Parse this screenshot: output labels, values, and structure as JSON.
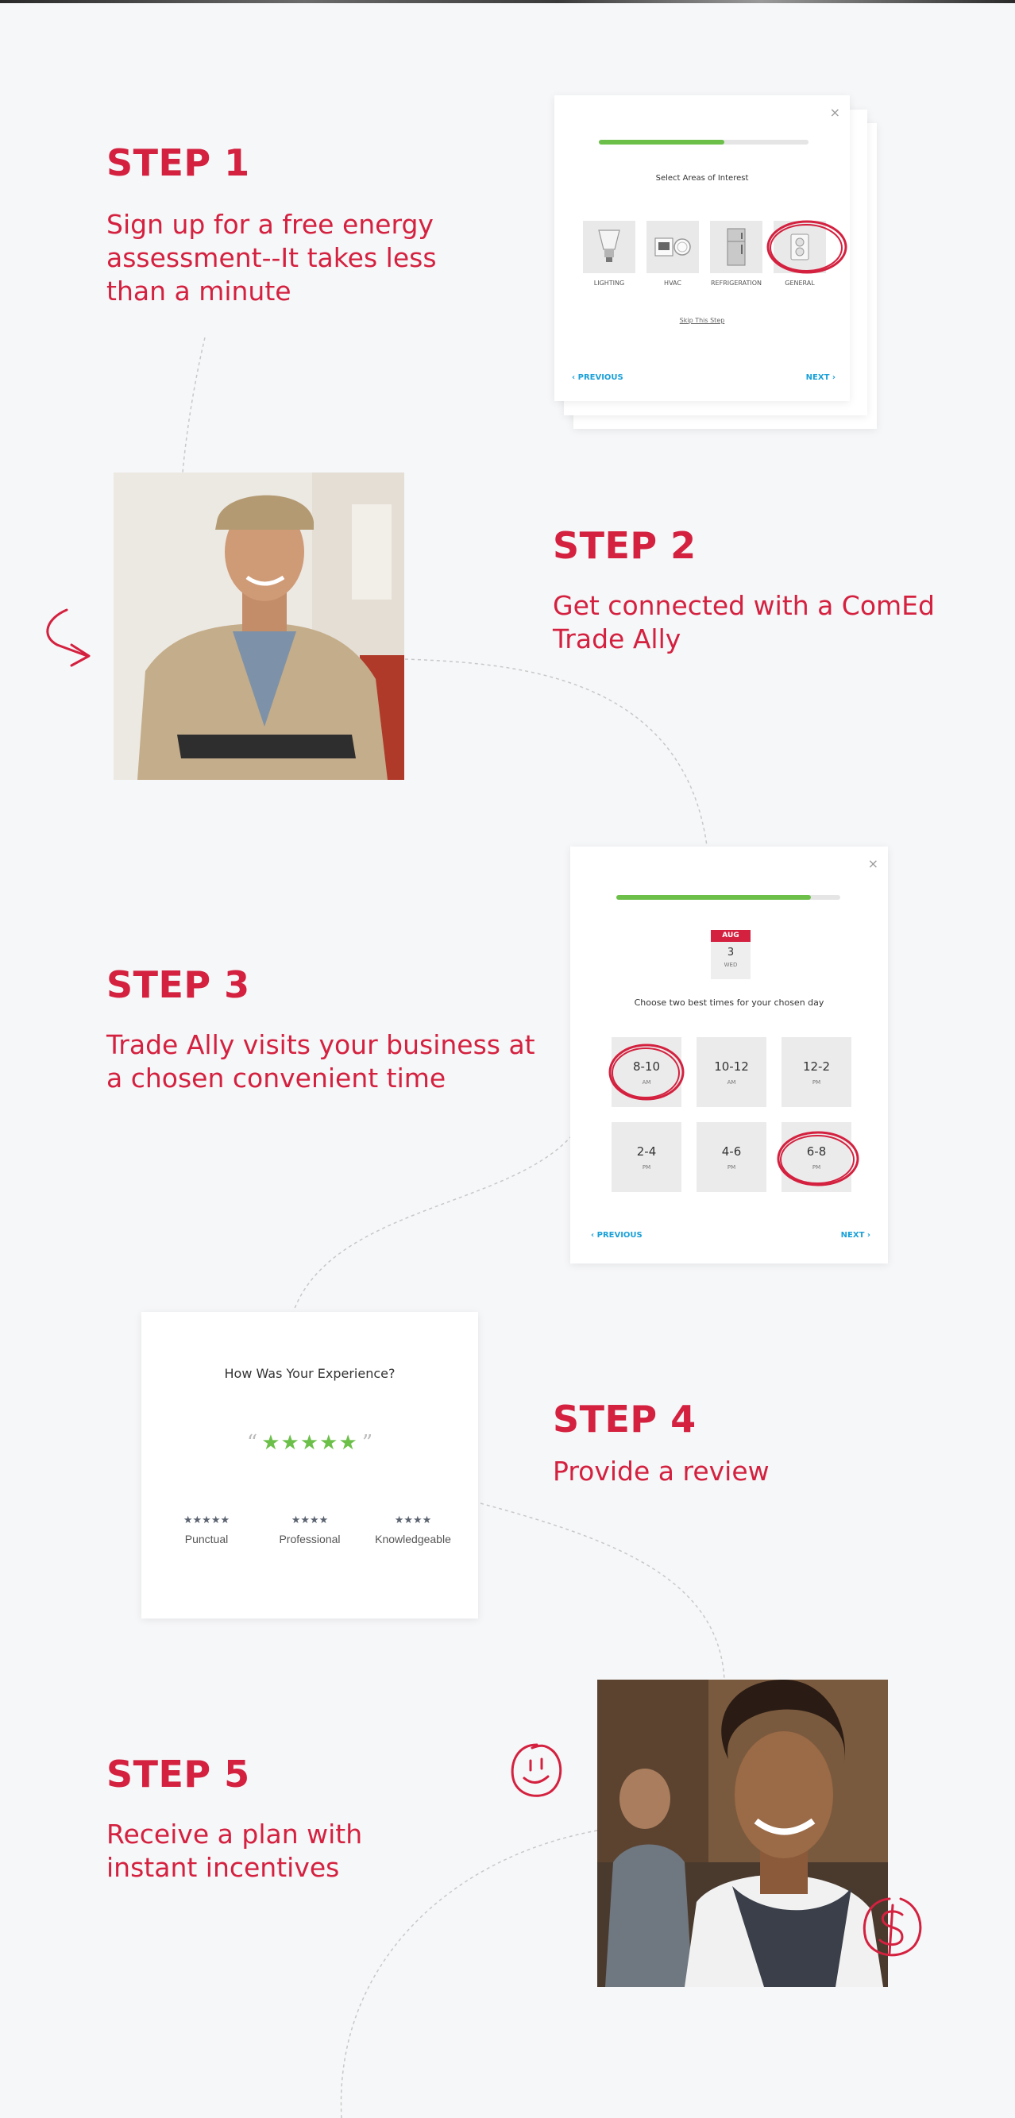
{
  "steps": [
    {
      "title": "STEP 1",
      "text": "Sign up for a free energy assessment--It takes less than a minute"
    },
    {
      "title": "STEP 2",
      "text": "Get connected with a ComEd Trade Ally"
    },
    {
      "title": "STEP 3",
      "text": "Trade Ally visits your business at a chosen convenient time"
    },
    {
      "title": "STEP 4",
      "text": "Provide a review"
    },
    {
      "title": "STEP 5",
      "text": "Receive a plan with instant incentives"
    }
  ],
  "areas_card": {
    "close": "×",
    "progress": 0.6,
    "title": "Select Areas of Interest",
    "areas": [
      {
        "label": "LIGHTING",
        "icon": "light-bulb-icon"
      },
      {
        "label": "HVAC",
        "icon": "thermostat-icon"
      },
      {
        "label": "REFRIGERATION",
        "icon": "refrigerator-icon"
      },
      {
        "label": "GENERAL",
        "icon": "outlet-icon"
      }
    ],
    "selected": "GENERAL",
    "skip": "Skip This Step",
    "previous": "PREVIOUS",
    "next": "NEXT"
  },
  "schedule_card": {
    "close": "×",
    "progress": 0.87,
    "calendar": {
      "month": "AUG",
      "day": "3",
      "weekday": "WED"
    },
    "title": "Choose two best times for your chosen day",
    "slots": [
      {
        "time": "8-10",
        "ampm": "AM",
        "selected": true
      },
      {
        "time": "10-12",
        "ampm": "AM",
        "selected": false
      },
      {
        "time": "12-2",
        "ampm": "PM",
        "selected": false
      },
      {
        "time": "2-4",
        "ampm": "PM",
        "selected": false
      },
      {
        "time": "4-6",
        "ampm": "PM",
        "selected": false
      },
      {
        "time": "6-8",
        "ampm": "PM",
        "selected": true
      }
    ],
    "previous": "PREVIOUS",
    "next": "NEXT"
  },
  "review_card": {
    "title": "How Was Your Experience?",
    "open_quote": "“",
    "close_quote": "”",
    "stars": "★★★★★",
    "overall_rating": 5,
    "ratings": [
      {
        "label": "Punctual",
        "stars": "★★★★★",
        "value": 5
      },
      {
        "label": "Professional",
        "stars": "★★★★",
        "value": 4
      },
      {
        "label": "Knowledgeable",
        "stars": "★★★★",
        "value": 4
      }
    ]
  },
  "photos": {
    "step2": "technician-photo",
    "step5": "barista-photo"
  },
  "colors": {
    "accent": "#d4213f",
    "progress": "#6cc04a",
    "link": "#1aa0d8",
    "background": "#f6f7f9"
  }
}
